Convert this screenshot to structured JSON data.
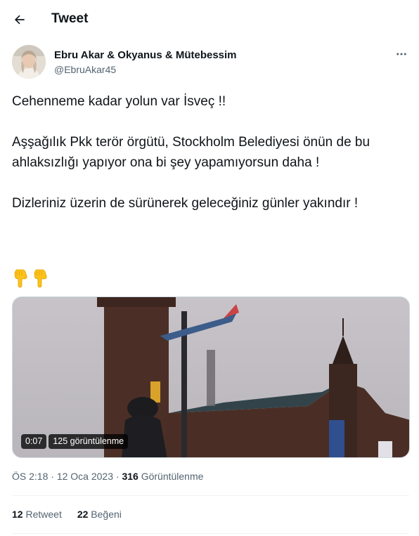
{
  "header": {
    "title": "Tweet",
    "back_icon": "arrow-left-icon"
  },
  "author": {
    "display_name": "Ebru Akar & Okyanus & Mütebessim",
    "handle": "@EbruAkar45",
    "more_icon": "more-horizontal-icon"
  },
  "tweet": {
    "paragraphs": [
      "Cehenneme kadar yolun var İsveç !!",
      "Aşşağılık Pkk terör örgütü, Stockholm Belediyesi önün de bu ahlaksızlığı yapıyor ona bi şey yapamıyorsun daha !",
      "Dizleriniz üzerin de sürünerek geleceğiniz günler yakındır !"
    ],
    "emojis": [
      "backhand-index-pointing-down",
      "backhand-index-pointing-down"
    ]
  },
  "media": {
    "type": "video",
    "duration": "0:07",
    "views_label": "125 görüntülenme"
  },
  "meta": {
    "time": "ÖS 2:18",
    "date": "12 Oca 2023",
    "separator": "·",
    "views_count": "316",
    "views_label": "Görüntülenme"
  },
  "stats": {
    "retweets_count": "12",
    "retweets_label": "Retweet",
    "likes_count": "22",
    "likes_label": "Beğeni"
  },
  "colors": {
    "text_primary": "#0f1419",
    "text_secondary": "#536471",
    "divider": "#eff3f4",
    "emoji_yellow": "#fcc21b"
  }
}
